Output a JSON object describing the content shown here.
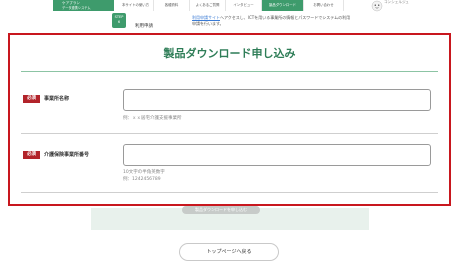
{
  "header": {
    "logo_line1": "ケアプラン",
    "logo_line2": "データ連携システム",
    "logo_line3": "ヘルプデスクサポートサイト",
    "nav": [
      {
        "label": "本サイトの使い方",
        "active": false
      },
      {
        "label": "各種資料",
        "active": false
      },
      {
        "label": "よくあるご質問",
        "active": false
      },
      {
        "label": "インタビュー",
        "active": false
      },
      {
        "label": "製品ダウンロード",
        "active": true
      },
      {
        "label": "お問い合わせ",
        "active": false
      }
    ],
    "consult_label": "コンシェルジュ"
  },
  "background": {
    "step_label": "STEP",
    "step_number": "6",
    "item_label": "利用申請",
    "desc_link": "利用申請サイト",
    "desc_rest": "へアクセスし、ICTを用いる事業所の情報とパスワードでシステムの利用申請を行います。"
  },
  "form": {
    "title": "製品ダウンロード申し込み",
    "fields": [
      {
        "required": "必須",
        "label": "事業所名称",
        "value": "",
        "hint": "例：ｘｘ居宅介護支援事業所"
      },
      {
        "required": "必須",
        "label": "介護保険事業所番号",
        "value": "",
        "hint": "10文字の半角英数字",
        "hint2": "例：1242456789"
      }
    ]
  },
  "submit_label": "製品ダウンロードを申し込む",
  "top_page_button": "トップページへ戻る"
}
